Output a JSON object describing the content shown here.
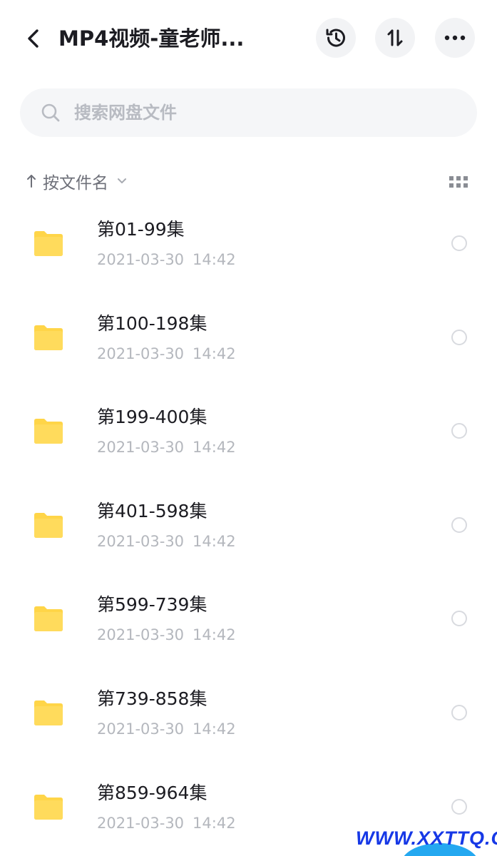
{
  "header": {
    "title": "MP4视频-童老师...",
    "history_icon": "history-icon",
    "sort_icon": "sort-arrows-icon",
    "more_icon": "more-dots-icon"
  },
  "search": {
    "placeholder": "搜索网盘文件",
    "value": ""
  },
  "sort_bar": {
    "label": "按文件名",
    "direction": "ascending"
  },
  "files": [
    {
      "name": "第01-99集",
      "date": "2021-03-30",
      "time": "14:42",
      "type": "folder"
    },
    {
      "name": "第100-198集",
      "date": "2021-03-30",
      "time": "14:42",
      "type": "folder"
    },
    {
      "name": "第199-400集",
      "date": "2021-03-30",
      "time": "14:42",
      "type": "folder"
    },
    {
      "name": "第401-598集",
      "date": "2021-03-30",
      "time": "14:42",
      "type": "folder"
    },
    {
      "name": "第599-739集",
      "date": "2021-03-30",
      "time": "14:42",
      "type": "folder"
    },
    {
      "name": "第739-858集",
      "date": "2021-03-30",
      "time": "14:42",
      "type": "folder"
    },
    {
      "name": "第859-964集",
      "date": "2021-03-30",
      "time": "14:42",
      "type": "folder"
    }
  ],
  "watermark": "WWW.XXTTQ.COM",
  "colors": {
    "folder": "#ffd548",
    "title_text": "#1c1c22",
    "secondary_text": "#b4b7bd",
    "button_bg": "#f2f3f5",
    "watermark_text": "#1638e6",
    "watermark_blob": "#24a8f0"
  }
}
